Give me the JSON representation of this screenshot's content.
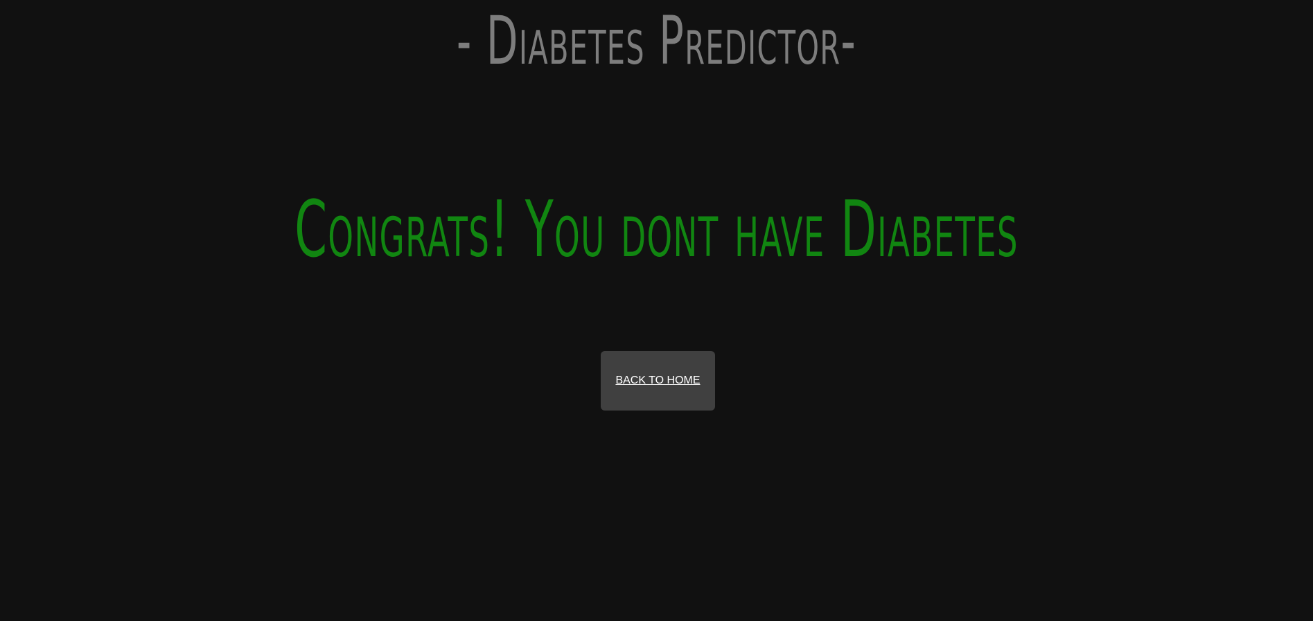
{
  "header": {
    "title": "- Diabetes Predictor-"
  },
  "result": {
    "message": "Congrats! You dont have Diabetes"
  },
  "actions": {
    "back_home_label": "BACK TO HOME"
  },
  "colors": {
    "background": "#111111",
    "title": "#7d7d7d",
    "success": "#118611",
    "button": "#404040",
    "button_text": "#ffffff"
  }
}
